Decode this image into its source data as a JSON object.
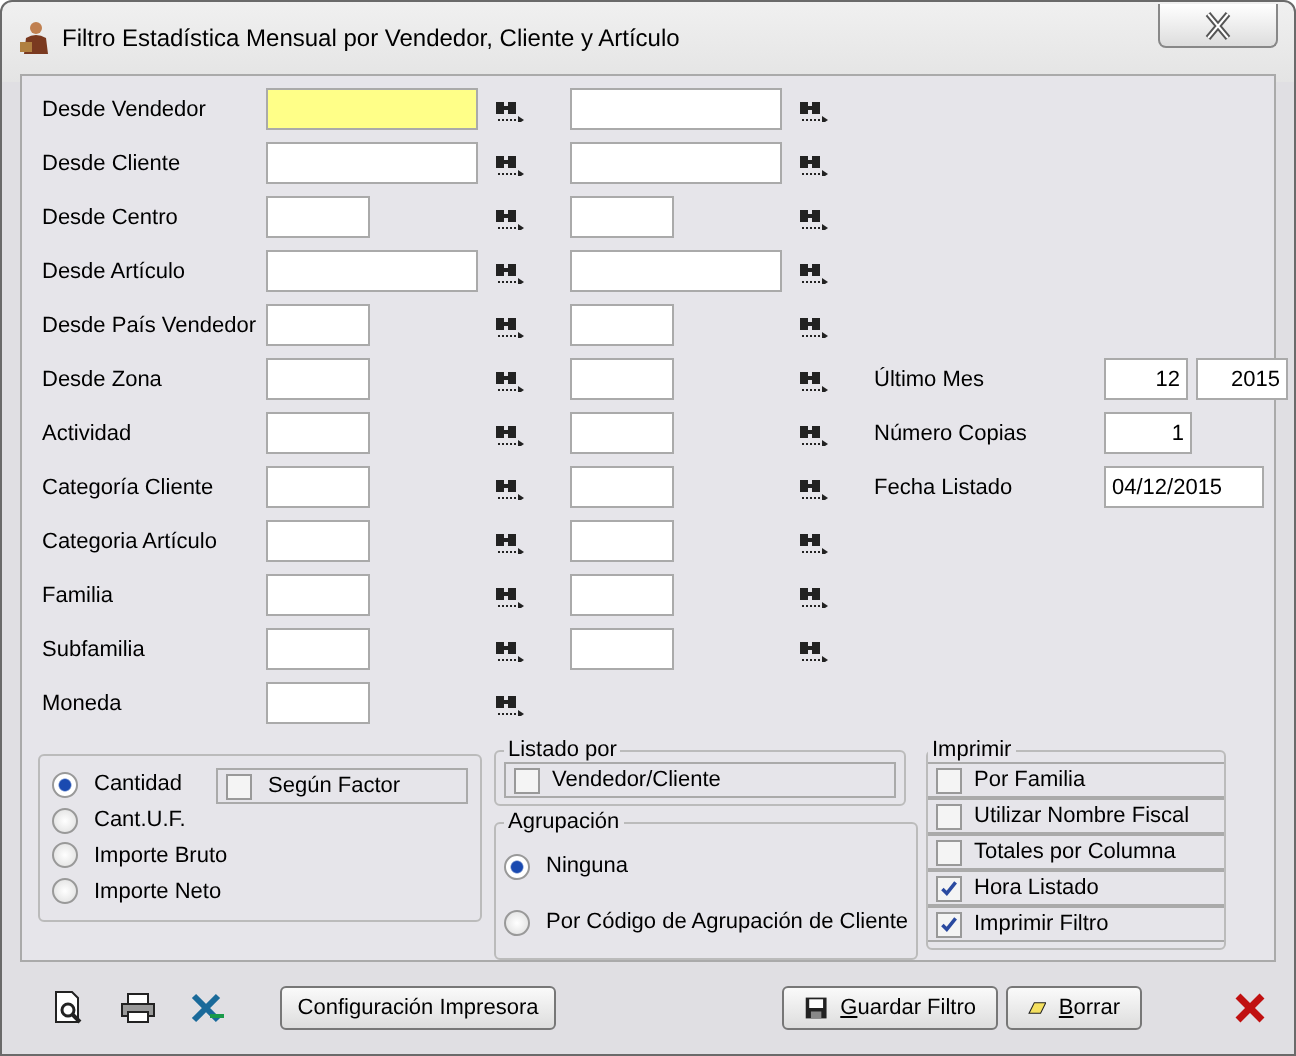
{
  "window": {
    "title": "Filtro Estadística Mensual por Vendedor, Cliente y Artículo"
  },
  "rows": [
    {
      "label": "Desde Vendedor",
      "kind": "wide",
      "focused": true,
      "second": true
    },
    {
      "label": "Desde Cliente",
      "kind": "wide",
      "focused": false,
      "second": true
    },
    {
      "label": "Desde Centro",
      "kind": "short",
      "focused": false,
      "second": true
    },
    {
      "label": "Desde Artículo",
      "kind": "wide",
      "focused": false,
      "second": true
    },
    {
      "label": "Desde País Vendedor",
      "kind": "short",
      "focused": false,
      "second": true
    },
    {
      "label": "Desde Zona",
      "kind": "short",
      "focused": false,
      "second": true,
      "extra": {
        "label": "Último Mes",
        "fields": [
          {
            "value": "12",
            "kind": "month"
          },
          {
            "value": "2015",
            "kind": "year"
          }
        ]
      }
    },
    {
      "label": "Actividad",
      "kind": "short",
      "focused": false,
      "second": true,
      "extra": {
        "label": "Número Copias",
        "fields": [
          {
            "value": "1",
            "kind": "count"
          }
        ]
      }
    },
    {
      "label": "Categoría Cliente",
      "kind": "short",
      "focused": false,
      "second": true,
      "extra": {
        "label": "Fecha Listado",
        "fields": [
          {
            "value": "04/12/2015",
            "kind": "date"
          }
        ]
      }
    },
    {
      "label": "Categoria Artículo",
      "kind": "short",
      "focused": false,
      "second": true
    },
    {
      "label": "Familia",
      "kind": "short",
      "focused": false,
      "second": true
    },
    {
      "label": "Subfamilia",
      "kind": "short",
      "focused": false,
      "second": true
    },
    {
      "label": "Moneda",
      "kind": "short",
      "focused": false,
      "second": false
    }
  ],
  "quantity": {
    "options": [
      {
        "label": "Cantidad",
        "selected": true
      },
      {
        "label": "Cant.U.F.",
        "selected": false
      },
      {
        "label": "Importe Bruto",
        "selected": false
      },
      {
        "label": "Importe Neto",
        "selected": false
      }
    ],
    "factor": {
      "label": "Según Factor",
      "checked": false
    }
  },
  "listado": {
    "title": "Listado por",
    "option": {
      "label": "Vendedor/Cliente",
      "checked": false
    }
  },
  "agrupacion": {
    "title": "Agrupación",
    "options": [
      {
        "label": "Ninguna",
        "selected": true
      },
      {
        "label": "Por Código de Agrupación de Cliente",
        "selected": false
      }
    ]
  },
  "imprimir": {
    "title": "Imprimir",
    "options": [
      {
        "label": "Por Familia",
        "checked": false
      },
      {
        "label": "Utilizar Nombre Fiscal",
        "checked": false
      },
      {
        "label": "Totales por Columna",
        "checked": false
      },
      {
        "label": "Hora Listado",
        "checked": true
      },
      {
        "label": "Imprimir Filtro",
        "checked": true
      }
    ]
  },
  "buttons": {
    "config": "Configuración Impresora",
    "save": "Guardar Filtro",
    "clear": "Borrar"
  }
}
